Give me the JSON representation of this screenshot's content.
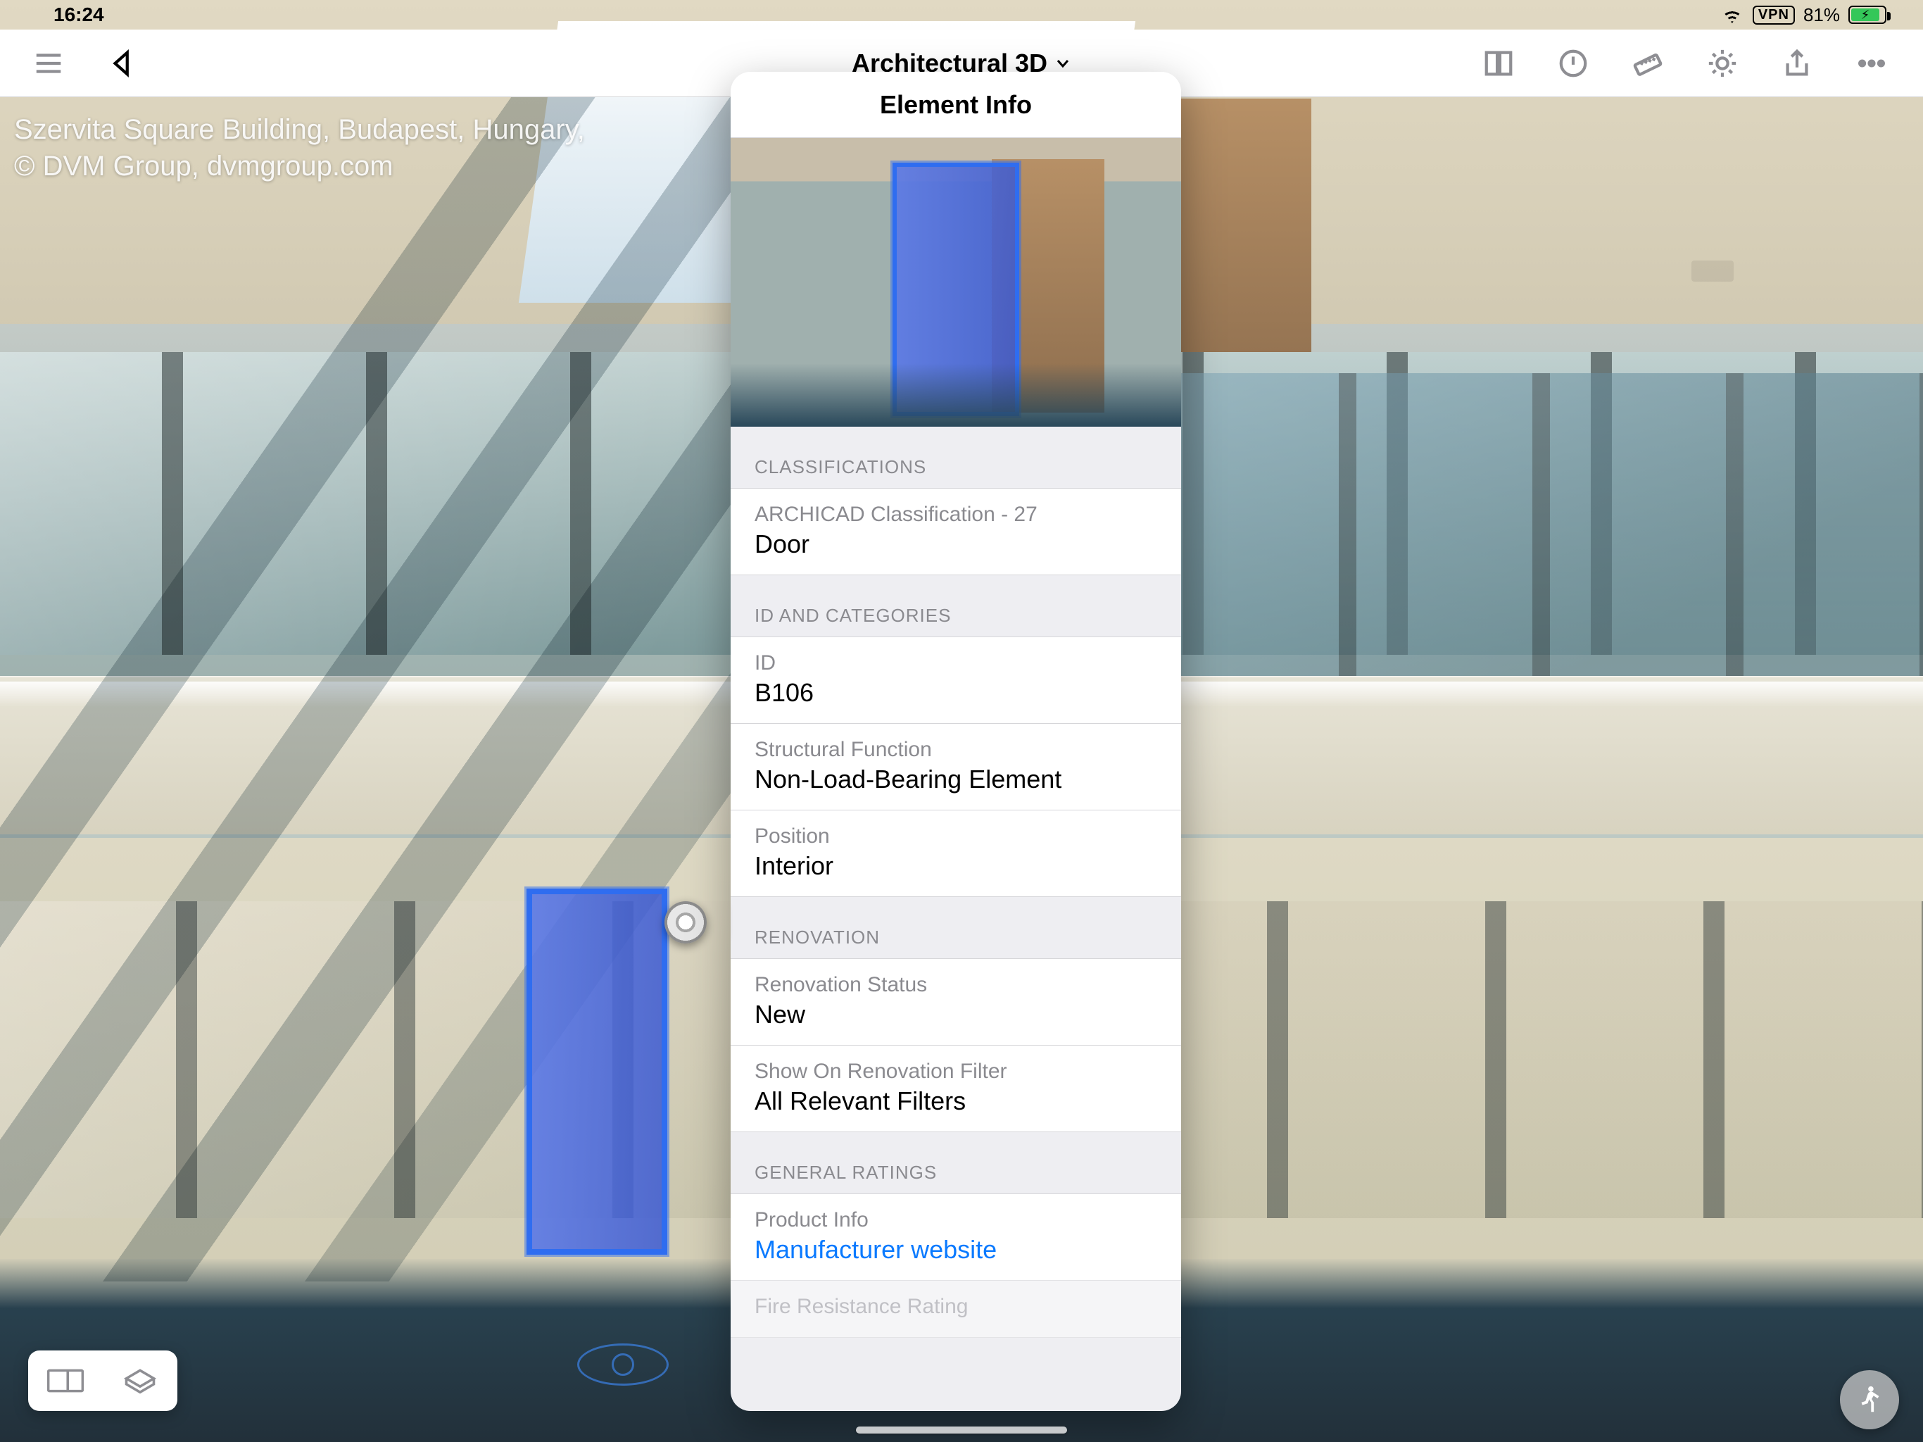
{
  "status": {
    "time": "16:24",
    "vpn": "VPN",
    "battery_pct": "81%"
  },
  "nav": {
    "title": "Architectural 3D"
  },
  "caption": {
    "line1": "Szervita Square Building, Budapest, Hungary,",
    "line2": "© DVM Group, dvmgroup.com"
  },
  "popover": {
    "title": "Element Info",
    "sections": {
      "classifications": {
        "header": "CLASSIFICATIONS",
        "items": [
          {
            "label": "ARCHICAD Classification - 27",
            "value": "Door"
          }
        ]
      },
      "id_and_categories": {
        "header": "ID AND CATEGORIES",
        "items": [
          {
            "label": "ID",
            "value": "B106"
          },
          {
            "label": "Structural Function",
            "value": "Non-Load-Bearing Element"
          },
          {
            "label": "Position",
            "value": "Interior"
          }
        ]
      },
      "renovation": {
        "header": "RENOVATION",
        "items": [
          {
            "label": "Renovation Status",
            "value": "New"
          },
          {
            "label": "Show On Renovation Filter",
            "value": "All Relevant Filters"
          }
        ]
      },
      "general_ratings": {
        "header": "GENERAL RATINGS",
        "items": [
          {
            "label": "Product Info",
            "value": "Manufacturer website",
            "is_link": true
          },
          {
            "label": "Fire Resistance Rating",
            "value": ""
          }
        ]
      }
    }
  }
}
